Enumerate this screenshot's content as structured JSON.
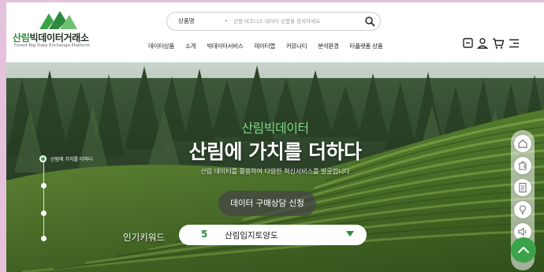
{
  "brand": {
    "name_green": "산림",
    "name_dark": "빅데이터거래소",
    "subtitle": "Forest Big Data Exchange Platform",
    "color": "#2d8a3e"
  },
  "search": {
    "category": "상품명",
    "placeholder": "산림 비즈니스 데이터 상품을 검색하세요"
  },
  "nav": [
    "데이터상품",
    "소개",
    "빅데이터서비스",
    "데이터맵",
    "커뮤니티",
    "분석환경",
    "타플랫폼 상품"
  ],
  "utility_icons": [
    "admin-icon",
    "user-icon",
    "cart-icon",
    "menu-icon"
  ],
  "hero": {
    "kicker": "산림빅데이터",
    "headline": "산림에 가치를 더하다",
    "subline": "산림 데이터를 활용하여 다양한 혁신서비스를 발굴합니다",
    "cta_label": "데이터 구매상담 신청",
    "timeline_label": "산림에 가치를 더하다"
  },
  "keyword": {
    "label": "인기키워드",
    "rank": "5",
    "text": "산림입지토양도"
  },
  "quick_menu": [
    "home-icon",
    "puzzle-icon",
    "document-icon",
    "lightbulb-icon",
    "speaker-icon",
    "share-icon"
  ]
}
